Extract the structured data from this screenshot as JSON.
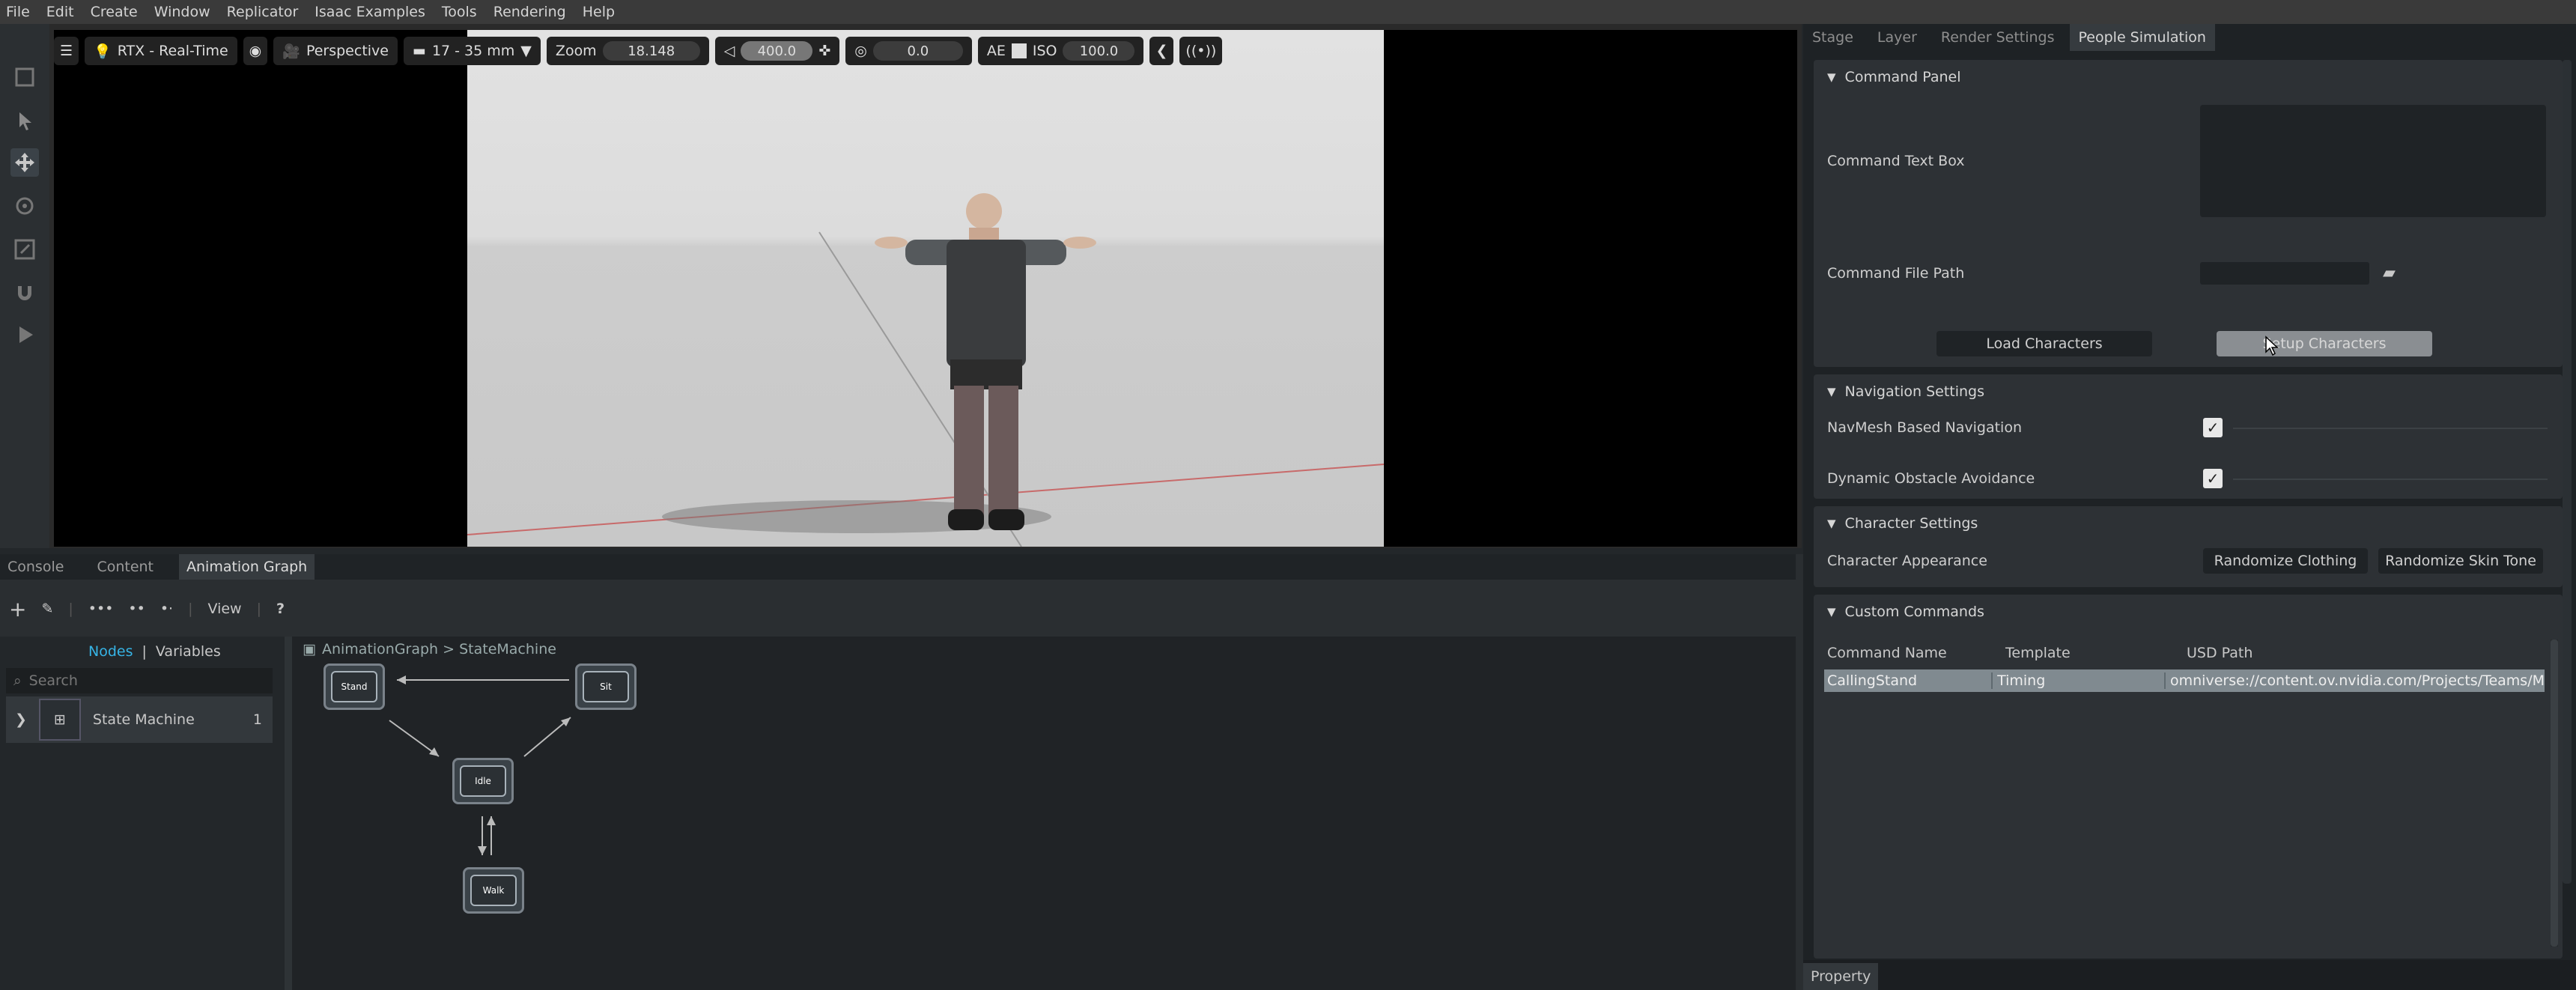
{
  "menu": [
    "File",
    "Edit",
    "Create",
    "Window",
    "Replicator",
    "Isaac Examples",
    "Tools",
    "Rendering",
    "Help"
  ],
  "viewport": {
    "renderer": "RTX - Real-Time",
    "camera": "Perspective",
    "lens": "17 - 35 mm",
    "zoom_label": "Zoom",
    "zoom_value": "18.148",
    "focal_value": "400.0",
    "exposure_value": "0.0",
    "ae_label": "AE",
    "iso_label": "ISO",
    "iso_value": "100.0"
  },
  "bottom_tabs": [
    "Console",
    "Content",
    "Animation Graph"
  ],
  "graph": {
    "view_label": "View",
    "help": "?",
    "nodes_tab": "Nodes",
    "variables_tab": "Variables",
    "search_placeholder": "Search",
    "tree_item": "State Machine",
    "tree_count": "1",
    "breadcrumb": "AnimationGraph > StateMachine",
    "states": [
      "Stand",
      "Sit",
      "Idle",
      "Walk"
    ]
  },
  "right_tabs": [
    "Stage",
    "Layer",
    "Render Settings",
    "People Simulation"
  ],
  "command_panel": {
    "title": "Command Panel",
    "text_box_label": "Command Text Box",
    "file_path_label": "Command File Path",
    "load_button": "Load Characters",
    "setup_button": "Setup Characters"
  },
  "navigation": {
    "title": "Navigation Settings",
    "navmesh_label": "NavMesh Based Navigation",
    "navmesh_checked": true,
    "obstacle_label": "Dynamic Obstacle Avoidance",
    "obstacle_checked": true
  },
  "character": {
    "title": "Character Settings",
    "appearance_label": "Character Appearance",
    "clothing_button": "Randomize Clothing",
    "skin_button": "Randomize Skin Tone"
  },
  "custom_commands": {
    "title": "Custom Commands",
    "headers": [
      "Command Name",
      "Template",
      "USD Path"
    ],
    "rows": [
      [
        "CallingStand",
        "Timing",
        "omniverse://content.ov.nvidia.com/Projects/Teams/M"
      ]
    ]
  },
  "property_tab": "Property"
}
